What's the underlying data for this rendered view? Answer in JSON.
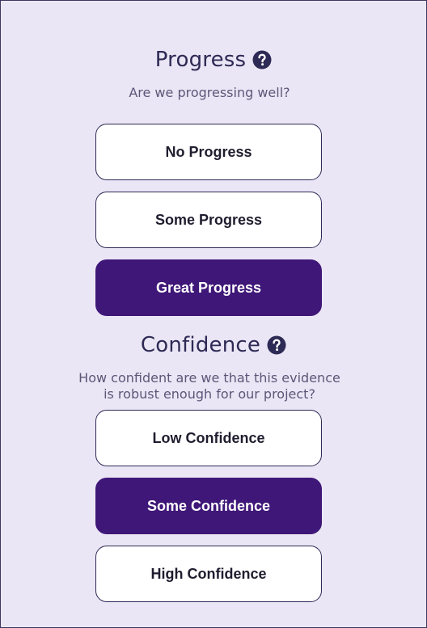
{
  "progress": {
    "title": "Progress",
    "question": "Are we progressing well?",
    "options": [
      {
        "label": "No Progress",
        "selected": false
      },
      {
        "label": "Some Progress",
        "selected": false
      },
      {
        "label": "Great Progress",
        "selected": true
      }
    ]
  },
  "confidence": {
    "title": "Confidence",
    "question_line1": "How confident are we that this evidence",
    "question_line2": "is robust enough for our project?",
    "options": [
      {
        "label": "Low Confidence",
        "selected": false
      },
      {
        "label": "Some Confidence",
        "selected": true
      },
      {
        "label": "High Confidence",
        "selected": false
      }
    ]
  },
  "colors": {
    "background": "#ebe6f5",
    "accent": "#3f1778",
    "text_dark": "#2d2a55"
  },
  "icons": {
    "help": "question-circle-icon"
  }
}
